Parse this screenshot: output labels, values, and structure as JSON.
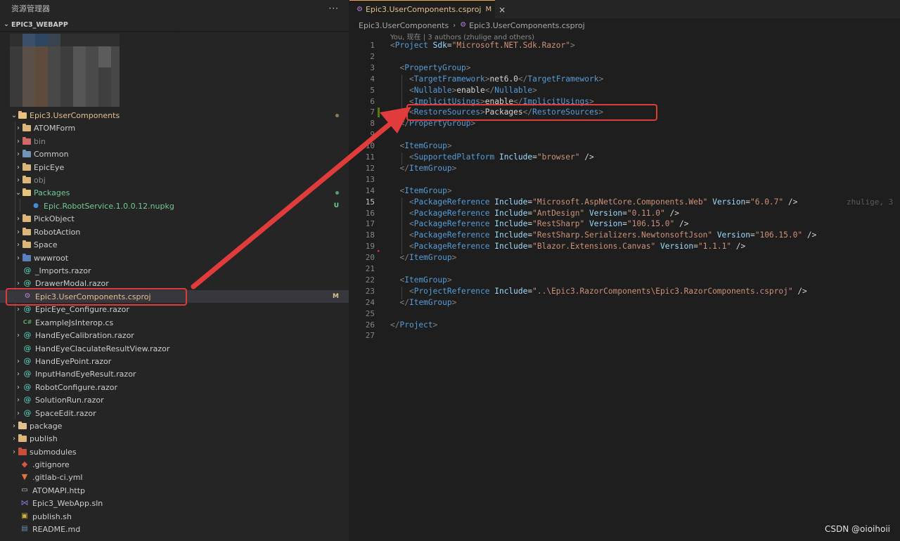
{
  "sidebar": {
    "title": "资源管理器",
    "more": "···",
    "section": "EPIC3_WEBAPP",
    "items": [
      {
        "label": "Epic3.UserComponents",
        "color": "#e2c08d"
      },
      {
        "label": "ATOMForm"
      },
      {
        "label": "bin",
        "color": "#8b8b8b"
      },
      {
        "label": "Common"
      },
      {
        "label": "EpicEye"
      },
      {
        "label": "obj",
        "color": "#8b8b8b"
      },
      {
        "label": "Packages",
        "color": "#73c991"
      },
      {
        "label": "Epic.RobotService.1.0.0.12.nupkg",
        "color": "#73c991",
        "badge": "U"
      },
      {
        "label": "PickObject"
      },
      {
        "label": "RobotAction"
      },
      {
        "label": "Space"
      },
      {
        "label": "wwwroot"
      },
      {
        "label": "_Imports.razor"
      },
      {
        "label": "DrawerModal.razor"
      },
      {
        "label": "Epic3.UserComponents.csproj",
        "color": "#e2c08d",
        "badge": "M"
      },
      {
        "label": "EpicEye_Configure.razor"
      },
      {
        "label": "ExampleJsInterop.cs"
      },
      {
        "label": "HandEyeCalibration.razor"
      },
      {
        "label": "HandEyeClaculateResultView.razor"
      },
      {
        "label": "HandEyePoint.razor"
      },
      {
        "label": "InputHandEyeResult.razor"
      },
      {
        "label": "RobotConfigure.razor"
      },
      {
        "label": "SolutionRun.razor"
      },
      {
        "label": "SpaceEdit.razor"
      },
      {
        "label": "package"
      },
      {
        "label": "publish"
      },
      {
        "label": "submodules"
      },
      {
        "label": ".gitignore"
      },
      {
        "label": ".gitlab-ci.yml"
      },
      {
        "label": "ATOMAPI.http"
      },
      {
        "label": "Epic3_WebApp.sln"
      },
      {
        "label": "publish.sh"
      },
      {
        "label": "README.md"
      }
    ]
  },
  "editor": {
    "tab": {
      "title": "Epic3.UserComponents.csproj",
      "modified": "M",
      "close": "×"
    },
    "breadcrumb": [
      "Epic3.UserComponents",
      "Epic3.UserComponents.csproj"
    ],
    "blame_header": "You, 现在 | 3 authors (zhulige and others)",
    "inline_blame": "zhulige, 3",
    "current_line": 15,
    "line_numbers": [
      "1",
      "2",
      "3",
      "4",
      "5",
      "6",
      "7",
      "8",
      "9",
      "10",
      "11",
      "12",
      "13",
      "14",
      "15",
      "16",
      "17",
      "18",
      "19",
      "20",
      "21",
      "22",
      "23",
      "24",
      "25",
      "26",
      "27"
    ],
    "lines": [
      "<Project Sdk=\"Microsoft.NET.Sdk.Razor\">",
      "",
      "  <PropertyGroup>",
      "    <TargetFramework>net6.0</TargetFramework>",
      "    <Nullable>enable</Nullable>",
      "    <ImplicitUsings>enable</ImplicitUsings>",
      "    <RestoreSources>Packages</RestoreSources>",
      "  </PropertyGroup>",
      "",
      "  <ItemGroup>",
      "    <SupportedPlatform Include=\"browser\" />",
      "  </ItemGroup>",
      "",
      "  <ItemGroup>",
      "    <PackageReference Include=\"Microsoft.AspNetCore.Components.Web\" Version=\"6.0.7\" />",
      "    <PackageReference Include=\"AntDesign\" Version=\"0.11.0\" />",
      "    <PackageReference Include=\"RestSharp\" Version=\"106.15.0\" />",
      "    <PackageReference Include=\"RestSharp.Serializers.NewtonsoftJson\" Version=\"106.15.0\" />",
      "    <PackageReference Include=\"Blazor.Extensions.Canvas\" Version=\"1.1.1\" />",
      "  </ItemGroup>",
      "",
      "  <ItemGroup>",
      "    <ProjectReference Include=\"..\\Epic3.RazorComponents\\Epic3.RazorComponents.csproj\" />",
      "  </ItemGroup>",
      "",
      "</Project>",
      ""
    ]
  },
  "watermark": "CSDN @oioihoii",
  "colors": {
    "accent_modified": "#e2c08d",
    "untracked": "#73c991",
    "annotation": "#e03c3c"
  }
}
